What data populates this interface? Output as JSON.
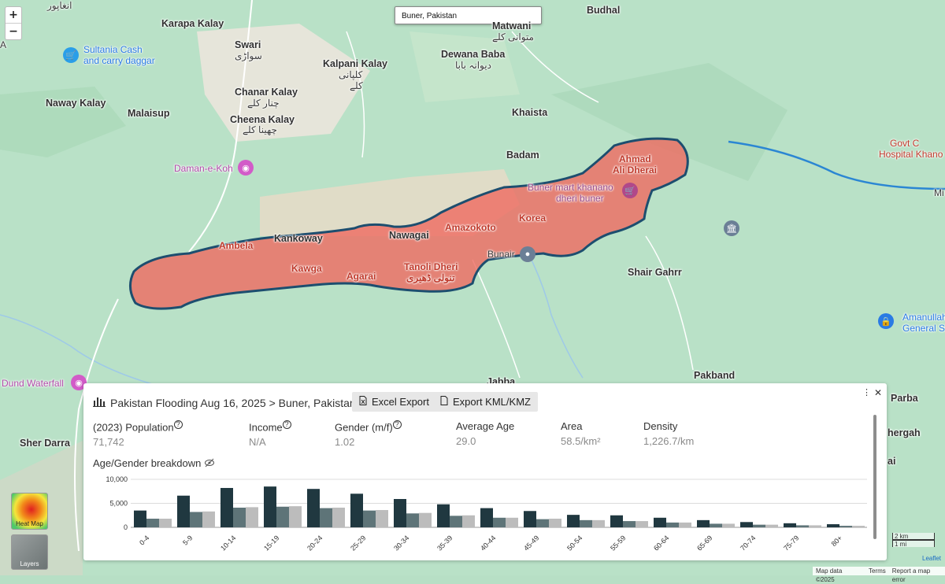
{
  "map": {
    "search_value": "Buner, Pakistan",
    "zoom_in": "+",
    "zoom_out": "−",
    "labels": {
      "anghapur": "Anghapur\nانغاپور",
      "karapa": "Karapa Kalay",
      "swari": "Swari",
      "swari_ur": "سواڑی",
      "sultania": "Sultania Cash",
      "sultania2": "and carry daggar",
      "kalpani": "Kalpani Kalay",
      "kalpani_ur": "کلپانی",
      "kalpani_ur2": "کلے",
      "dewana": "Dewana Baba",
      "dewana_ur": "دیوانہ بابا",
      "matwani": "Matwani",
      "matwani_ur": "متوانی کلے",
      "budhal": "Budhal",
      "naway": "Naway Kalay",
      "malaisup": "Malaisup",
      "chanar": "Chanar Kalay",
      "chanar_ur": "چنار کلے",
      "cheena": "Cheena Kalay",
      "cheena_ur": "چھینا کلے",
      "khaista": "Khaista",
      "badam": "Badam",
      "daman": "Daman-e-Koh",
      "ahmad": "Ahmad",
      "ali": "Ali Dherai",
      "govt1": "Govt C",
      "govt2": "Hospital Khano",
      "mart1": "Buner mart khanano",
      "mart2": "dheri buner",
      "mi": "Mi",
      "ambela": "Ambela",
      "kankoway": "Kankoway",
      "nawagai": "Nawagai",
      "amazokoto": "Amazokoto",
      "korea": "Korea",
      "kawga": "Kawga",
      "agarai": "Agarai",
      "tanoli": "Tanoli Dheri",
      "tanoli_ur": "تنولی ڈھیری",
      "bunair": "Bunair",
      "shair": "Shair Gahrr",
      "amanullah1": "Amanullah",
      "amanullah2": "General St",
      "dund": "Dund Waterfall",
      "pakband": "Pakband",
      "jabba": "Jabba",
      "parba": "Parba",
      "shergah": "hergah",
      "ai": "ai",
      "sher_darra": "Sher Darra",
      "a": "A"
    }
  },
  "panel": {
    "title": "Pakistan Flooding Aug 16, 2025 > Buner, Pakistan",
    "excel": "Excel Export",
    "kml": "Export KML/KMZ",
    "menu": "⋮",
    "close": "✕",
    "stats": [
      {
        "key": "(2023) Population",
        "value": "71,742",
        "help": "?"
      },
      {
        "key": "Income",
        "value": "N/A",
        "help": "?"
      },
      {
        "key": "Gender (m/f)",
        "value": "1.02",
        "help": "?"
      },
      {
        "key": "Average Age",
        "value": "29.0",
        "help": ""
      },
      {
        "key": "Area",
        "value": "58.5/km²",
        "help": ""
      },
      {
        "key": "Density",
        "value": "1,226.7/km",
        "help": ""
      }
    ],
    "breakdown_title": "Age/Gender breakdown"
  },
  "chart_data": {
    "type": "bar",
    "categories": [
      "0-4",
      "5-9",
      "10-14",
      "15-19",
      "20-24",
      "25-29",
      "30-34",
      "35-39",
      "40-44",
      "45-49",
      "50-54",
      "55-59",
      "60-64",
      "65-69",
      "70-74",
      "75-79",
      "80+"
    ],
    "series": [
      {
        "values": [
          3500,
          6600,
          8200,
          8500,
          8000,
          7000,
          5900,
          4800,
          4000,
          3400,
          2600,
          2500,
          2000,
          1500,
          1100,
          850,
          650
        ]
      },
      {
        "values": [
          1800,
          3200,
          4100,
          4300,
          4000,
          3500,
          2900,
          2400,
          2000,
          1700,
          1500,
          1300,
          1000,
          750,
          550,
          420,
          320
        ]
      },
      {
        "values": [
          1800,
          3300,
          4200,
          4400,
          4100,
          3600,
          3000,
          2500,
          2000,
          1800,
          1500,
          1300,
          1000,
          750,
          550,
          420,
          320
        ]
      }
    ],
    "yticks": [
      "10,000",
      "5,000",
      "0"
    ],
    "ylim": [
      0,
      10000
    ],
    "colors": [
      "#203840",
      "#5e7478",
      "#bcbcbc"
    ],
    "grid": true
  },
  "controls": {
    "heat_map": "Heat Map",
    "layers": "Layers",
    "scale_km": "2 km",
    "scale_mi": "1 mi",
    "leaflet": "Leaflet",
    "map_data": "Map data ©2025",
    "terms": "Terms",
    "report": "Report a map error"
  }
}
